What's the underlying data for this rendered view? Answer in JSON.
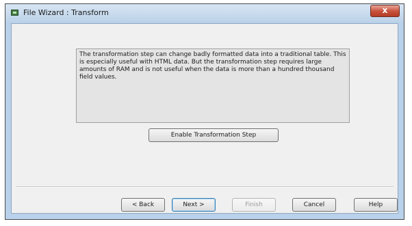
{
  "window": {
    "title": "File Wizard : Transform",
    "close_label": "x"
  },
  "description": {
    "text": "The transformation step can change badly formatted data into a traditional table. This is especially useful with HTML data. But the transformation step requires large amounts of RAM and is not useful when the data is more than a hundred thousand field values."
  },
  "actions": {
    "enable_transformation_label": "Enable Transformation Step"
  },
  "footer": {
    "back_label": "< Back",
    "next_label": "Next >",
    "finish_label": "Finish",
    "cancel_label": "Cancel",
    "help_label": "Help"
  }
}
